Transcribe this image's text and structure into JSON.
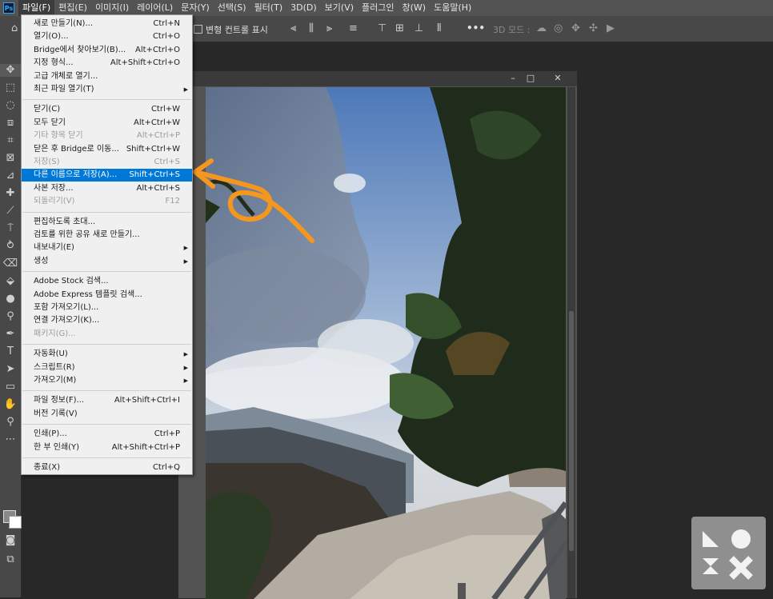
{
  "app_logo": "Ps",
  "menubar": [
    "파일(F)",
    "편집(E)",
    "이미지(I)",
    "레이어(L)",
    "문자(Y)",
    "선택(S)",
    "필터(T)",
    "3D(D)",
    "보기(V)",
    "플러그인",
    "창(W)",
    "도움말(H)"
  ],
  "options_bar": {
    "transform_controls_label": "변형 컨트롤 표시",
    "more_label": "•••",
    "mode_3d_label": "3D 모드 :"
  },
  "tools": [
    "move-icon",
    "marquee-icon",
    "lasso-icon",
    "object-select-icon",
    "crop-icon",
    "frame-icon",
    "eyedropper-icon",
    "spot-heal-icon",
    "brush-icon",
    "stamp-icon",
    "history-brush-icon",
    "eraser-icon",
    "paint-bucket-icon",
    "blur-icon",
    "dodge-icon",
    "pen-icon",
    "type-icon",
    "path-select-icon",
    "rectangle-icon",
    "hand-icon",
    "zoom-icon",
    "more-tools-icon"
  ],
  "window_controls": {
    "minimize": "–",
    "restore": "□",
    "close": "✕"
  },
  "file_menu": {
    "items": [
      {
        "label": "새로 만들기(N)...",
        "shortcut": "Ctrl+N"
      },
      {
        "label": "열기(O)...",
        "shortcut": "Ctrl+O"
      },
      {
        "label": "Bridge에서 찾아보기(B)...",
        "shortcut": "Alt+Ctrl+O"
      },
      {
        "label": "지정 형식...",
        "shortcut": "Alt+Shift+Ctrl+O"
      },
      {
        "label": "고급 개체로 열기..."
      },
      {
        "label": "최근 파일 열기(T)",
        "submenu": true
      },
      {
        "separator": true
      },
      {
        "label": "닫기(C)",
        "shortcut": "Ctrl+W"
      },
      {
        "label": "모두 닫기",
        "shortcut": "Alt+Ctrl+W"
      },
      {
        "label": "기타 항목 닫기",
        "shortcut": "Alt+Ctrl+P",
        "disabled": true
      },
      {
        "label": "닫은 후 Bridge로 이동...",
        "shortcut": "Shift+Ctrl+W"
      },
      {
        "label": "저장(S)",
        "shortcut": "Ctrl+S",
        "disabled": true
      },
      {
        "label": "다른 이름으로 저장(A)...",
        "shortcut": "Shift+Ctrl+S",
        "highlighted": true
      },
      {
        "label": "사본 저장...",
        "shortcut": "Alt+Ctrl+S"
      },
      {
        "label": "되돌리기(V)",
        "shortcut": "F12",
        "disabled": true
      },
      {
        "separator": true
      },
      {
        "label": "편집하도록 초대..."
      },
      {
        "label": "검토를 위한 공유 새로 만들기..."
      },
      {
        "label": "내보내기(E)",
        "submenu": true
      },
      {
        "label": "생성",
        "submenu": true
      },
      {
        "separator": true
      },
      {
        "label": "Adobe Stock 검색..."
      },
      {
        "label": "Adobe Express 템플릿 검색..."
      },
      {
        "label": "포함 가져오기(L)..."
      },
      {
        "label": "연결 가져오기(K)..."
      },
      {
        "label": "패키지(G)...",
        "disabled": true
      },
      {
        "separator": true
      },
      {
        "label": "자동화(U)",
        "submenu": true
      },
      {
        "label": "스크립트(R)",
        "submenu": true
      },
      {
        "label": "가져오기(M)",
        "submenu": true
      },
      {
        "separator": true
      },
      {
        "label": "파일 정보(F)...",
        "shortcut": "Alt+Shift+Ctrl+I"
      },
      {
        "label": "버전 기록(V)"
      },
      {
        "separator": true
      },
      {
        "label": "인쇄(P)...",
        "shortcut": "Ctrl+P"
      },
      {
        "label": "한 부 인쇄(Y)",
        "shortcut": "Alt+Shift+Ctrl+P"
      },
      {
        "separator": true
      },
      {
        "label": "종료(X)",
        "shortcut": "Ctrl+Q"
      }
    ]
  },
  "colors": {
    "highlight": "#0078d7",
    "annotation_arrow": "#f5961e",
    "menubar_bg": "#535353"
  }
}
